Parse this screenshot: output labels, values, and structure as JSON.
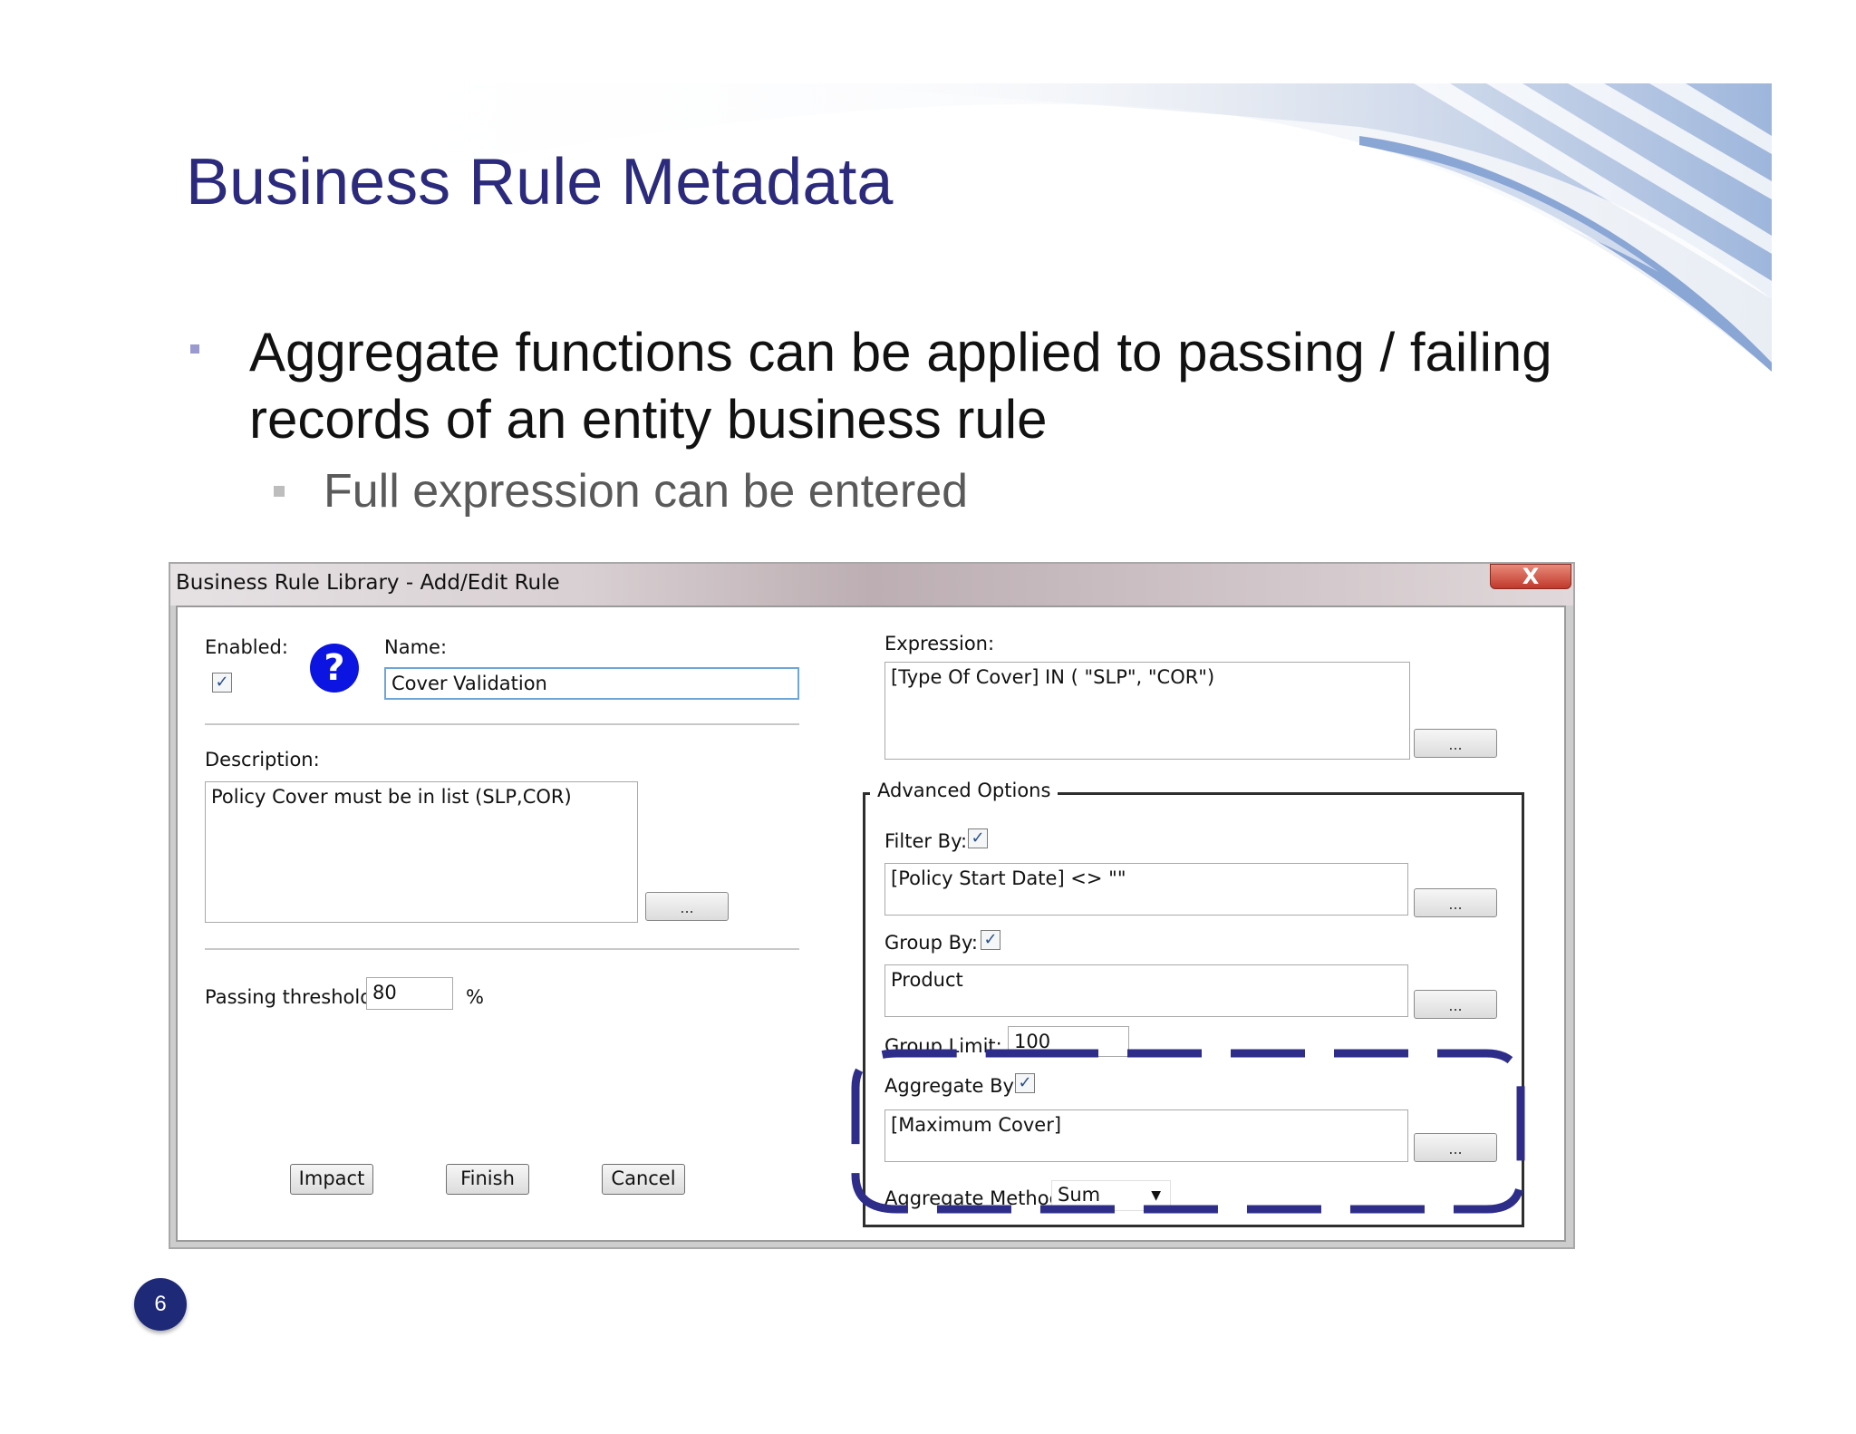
{
  "slide": {
    "title": "Business Rule Metadata",
    "bullet1": "Aggregate functions can be applied to passing / failing records of an entity business rule",
    "bullet2": "Full expression can be entered",
    "page_number": "6"
  },
  "colors": {
    "title": "#2b2a7c",
    "highlight_dash": "#2e2e8a",
    "help_icon": "#0b14e0",
    "page_badge": "#1e2a78"
  },
  "dialog": {
    "title": "Business Rule Library - Add/Edit Rule",
    "close_label": "X",
    "enabled_label": "Enabled:",
    "enabled_checked": "✓",
    "help_icon_glyph": "?",
    "name_label": "Name:",
    "name_value": "Cover Validation",
    "description_label": "Description:",
    "description_value": "Policy Cover must be in list (SLP,COR)",
    "passing_threshold_label": "Passing threshold:",
    "passing_threshold_value": "80",
    "percent_label": "%",
    "expression_label": "Expression:",
    "expression_value": "[Type Of Cover] IN ( \"SLP\", \"COR\")",
    "ellipsis_label": "...",
    "advanced_options": {
      "legend": "Advanced Options",
      "filter_by_label": "Filter By:",
      "filter_by_value": "[Policy Start Date] <> \"\"",
      "group_by_label": "Group By:",
      "group_by_value": "Product",
      "group_limit_label": "Group Limit:",
      "group_limit_value": "100",
      "aggregate_by_label": "Aggregate By:",
      "aggregate_by_value": "[Maximum Cover]",
      "aggregate_method_label": "Aggregate Method:",
      "aggregate_method_value": "Sum"
    },
    "buttons": {
      "impact": "Impact",
      "finish": "Finish",
      "cancel": "Cancel"
    }
  }
}
